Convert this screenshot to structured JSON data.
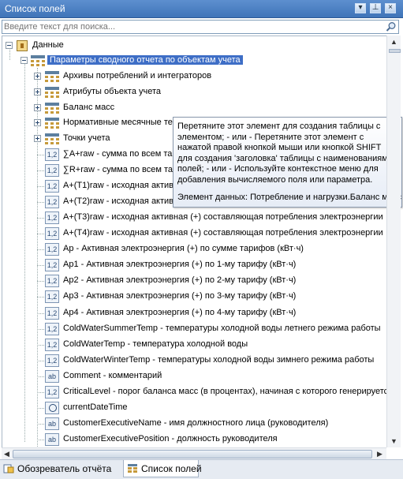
{
  "window": {
    "title": "Список полей"
  },
  "search": {
    "placeholder": "Введите текст для поиска..."
  },
  "tree": {
    "root": {
      "label": "Данные"
    },
    "selected_node": {
      "label": "Параметры сводного отчета по объектам учета"
    },
    "folders": [
      {
        "label": "Архивы потреблений и интеграторов"
      },
      {
        "label": "Атрибуты объекта учета"
      },
      {
        "label": "Баланс масс"
      },
      {
        "label": "Нормативные месячные тем"
      },
      {
        "label": "Точки учета"
      }
    ],
    "fields": [
      {
        "icon": "1,2",
        "label": "∑A+raw - сумма по всем тар"
      },
      {
        "icon": "1,2",
        "label": "∑R+raw - сумма по всем тар"
      },
      {
        "icon": "1,2",
        "label": "A+(T1)raw - исходная активн"
      },
      {
        "icon": "1,2",
        "label": "A+(T2)raw - исходная активн"
      },
      {
        "icon": "1,2",
        "label": "A+(T3)raw - исходная активная (+) составляющая потребления электроэнергии"
      },
      {
        "icon": "1,2",
        "label": "A+(T4)raw - исходная активная (+) составляющая потребления электроэнергии"
      },
      {
        "icon": "1,2",
        "label": "Ap - Активная электроэнергия (+) по сумме тарифов (кВт·ч)"
      },
      {
        "icon": "1,2",
        "label": "Ap1 - Активная электроэнергия (+) по 1-му тарифу (кВт·ч)"
      },
      {
        "icon": "1,2",
        "label": "Ap2 - Активная электроэнергия (+) по 2-му тарифу (кВт·ч)"
      },
      {
        "icon": "1,2",
        "label": "Ap3 - Активная электроэнергия (+) по 3-му тарифу (кВт·ч)"
      },
      {
        "icon": "1,2",
        "label": "Ap4 - Активная электроэнергия (+) по 4-му тарифу (кВт·ч)"
      },
      {
        "icon": "1,2",
        "label": "ColdWaterSummerTemp - температуры холодной воды летнего режима работы"
      },
      {
        "icon": "1,2",
        "label": "ColdWaterTemp - температура холодной воды"
      },
      {
        "icon": "1,2",
        "label": "ColdWaterWinterTemp - температуры холодной воды зимнего режима работы"
      },
      {
        "icon": "ab",
        "label": "Comment - комментарий"
      },
      {
        "icon": "1,2",
        "label": "CriticalLevel - порог баланса масс (в процентах), начиная с которого генерируетс"
      },
      {
        "icon": "clock",
        "label": "currentDateTime"
      },
      {
        "icon": "ab",
        "label": "CustomerExecutiveName - имя должностного лица (руководителя)"
      },
      {
        "icon": "ab",
        "label": "CustomerExecutivePosition - должность руководителя"
      }
    ]
  },
  "tooltip": {
    "description": "Перетяните этот элемент для создания таблицы с элементом; - или - Перетяните этот элемент с нажатой правой кнопкой мыши или кнопкой SHIFT для создания 'заголовка' таблицы с наименованиями полей; - или - Используйте контекстное меню для добавления вычисляемого поля или параметра.",
    "element": "Элемент данных: Потребление и нагрузки.Баланс масс"
  },
  "tabs": [
    {
      "label": "Обозреватель отчёта",
      "active": false
    },
    {
      "label": "Список полей",
      "active": true
    }
  ],
  "colors": {
    "titlebar": "#4a80c4",
    "selection": "#3e6ec6"
  }
}
